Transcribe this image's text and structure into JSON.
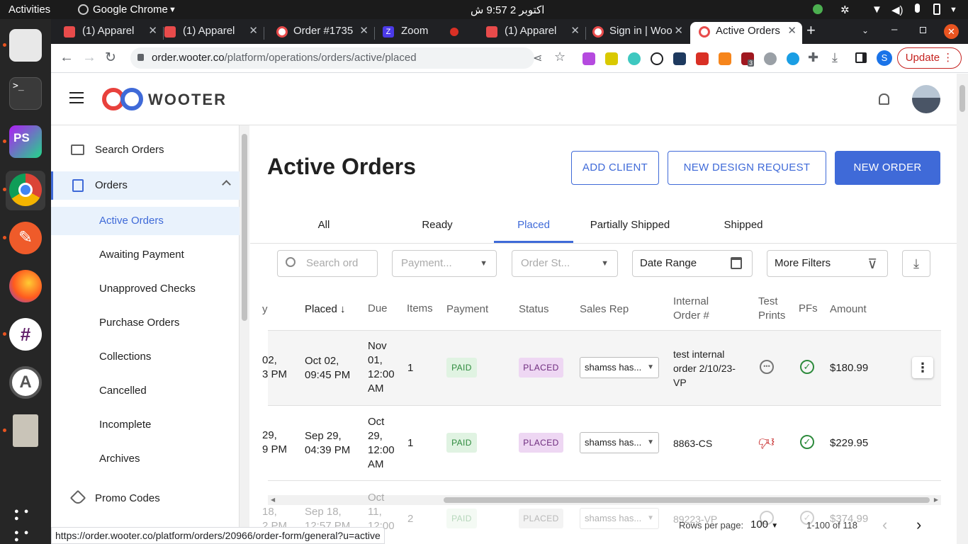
{
  "system": {
    "activities": "Activities",
    "app_menu": "Google Chrome",
    "clock": "اکتوبر 2  9:57 ش"
  },
  "browser": {
    "tabs": [
      {
        "title": "(1) Apparel",
        "color": "#e84b4b"
      },
      {
        "title": "(1) Apparel",
        "color": "#e84b4b"
      },
      {
        "title": "Order #1735",
        "color": "#e84b4b"
      },
      {
        "title": "Zoom",
        "color": "#4b3ae8"
      },
      {
        "title": "",
        "color": "#d93025"
      },
      {
        "title": "(1) Apparel",
        "color": "#e84b4b"
      },
      {
        "title": "Sign in | Woo",
        "color": "#e84b4b"
      },
      {
        "title": "Active Orders",
        "color": "#e84b4b"
      }
    ],
    "url_domain": "order.wooter.co",
    "url_path": "/platform/operations/orders/active/placed",
    "update_label": "Update",
    "profile_initial": "S",
    "ext_badge": "3",
    "status_url": "https://order.wooter.co/platform/orders/20966/order-form/general?u=active"
  },
  "app": {
    "logo_text": "WOOTER",
    "page_title": "Active Orders",
    "buttons": {
      "add_client": "ADD CLIENT",
      "new_design_request": "NEW DESIGN REQUEST",
      "new_order": "NEW ORDER"
    },
    "sidebar": {
      "search_orders": "Search Orders",
      "orders": "Orders",
      "sub_items": [
        "Active Orders",
        "Awaiting Payment",
        "Unapproved Checks",
        "Purchase Orders",
        "Collections",
        "Cancelled",
        "Incomplete",
        "Archives"
      ],
      "promo_codes": "Promo Codes"
    },
    "filter_tabs": [
      "All",
      "Ready",
      "Placed",
      "Partially Shipped",
      "Shipped"
    ],
    "active_tab": "Placed",
    "filters": {
      "search_placeholder": "Search ord",
      "payment_placeholder": "Payment...",
      "order_status_placeholder": "Order St...",
      "date_range": "Date Range",
      "more_filters": "More Filters"
    },
    "columns": {
      "truncated": "y",
      "placed": "Placed",
      "due": "Due",
      "items": "Items",
      "payment": "Payment",
      "status": "Status",
      "sales_rep": "Sales Rep",
      "internal_order_1": "Internal",
      "internal_order_2": "Order #",
      "test_prints_1": "Test",
      "test_prints_2": "Prints",
      "pfs": "PFs",
      "amount": "Amount"
    },
    "rows": [
      {
        "trunc1": "02,",
        "trunc2": "3 PM",
        "placed1": "Oct 02,",
        "placed2": "09:45 PM",
        "due1": "Nov",
        "due2": "01,",
        "due3": "12:00",
        "due4": "AM",
        "items": "1",
        "payment": "PAID",
        "status": "PLACED",
        "sales_rep": "shamss has...",
        "internal1": "test internal",
        "internal2": "order 2/10/23-",
        "internal3": "VP",
        "test_prints": "pending",
        "amount": "$180.99"
      },
      {
        "trunc1": "29,",
        "trunc2": "9 PM",
        "placed1": "Sep 29,",
        "placed2": "04:39 PM",
        "due1": "Oct",
        "due2": "29,",
        "due3": "12:00",
        "due4": "AM",
        "items": "1",
        "payment": "PAID",
        "status": "PLACED",
        "sales_rep": "shamss has...",
        "internal1": "8863-CS",
        "internal2": "",
        "internal3": "",
        "test_prints": "rejected",
        "amount": "$229.95"
      },
      {
        "trunc1": "18,",
        "trunc2": "2 PM",
        "placed1": "Sep 18,",
        "placed2": "12:57 PM",
        "due1": "Oct",
        "due2": "11,",
        "due3": "12:00",
        "due4": "",
        "items": "2",
        "payment": "PAID",
        "status": "PLACED",
        "sales_rep": "shamss has...",
        "internal1": "89223-VP",
        "internal2": "",
        "internal3": "",
        "test_prints": "pending",
        "amount": "$374.99"
      }
    ],
    "pagination": {
      "rows_per_page_label": "Rows per page:",
      "rows_per_page": "100",
      "range": "1-100 of 118"
    },
    "colors": {
      "accent": "#3f6ad8",
      "logo_red": "#e8413c"
    }
  }
}
